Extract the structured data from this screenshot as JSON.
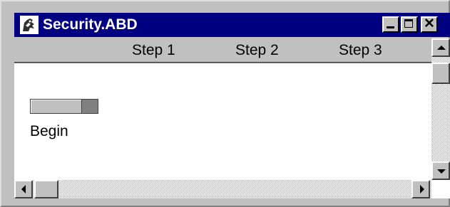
{
  "window": {
    "title": "Security.ABD",
    "icon": "app-icon",
    "controls": {
      "minimize_icon": "minimize-icon",
      "maximize_icon": "maximize-icon",
      "close_icon": "close-icon",
      "close_glyph": "✕"
    }
  },
  "header": {
    "steps": [
      "Step 1",
      "Step 2",
      "Step 3"
    ]
  },
  "main": {
    "progress": {
      "value": 0.78
    },
    "label": "Begin"
  },
  "scrollbars": {
    "vertical": {
      "up_icon": "arrow-up-icon",
      "down_icon": "arrow-down-icon"
    },
    "horizontal": {
      "left_icon": "arrow-left-icon",
      "right_icon": "arrow-right-icon"
    }
  },
  "colors": {
    "titlebar": "#000080",
    "face": "#c0c0c0",
    "content_bg": "#ffffff"
  }
}
